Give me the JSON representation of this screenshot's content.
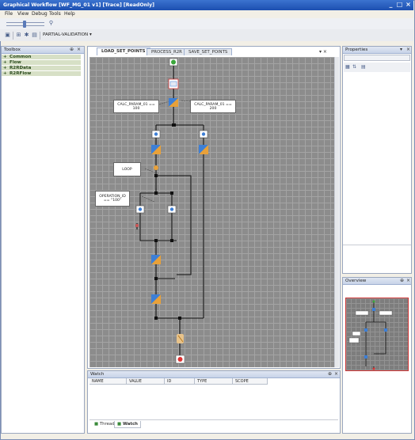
{
  "window": {
    "title": "Graphical Workflow [WF_MG_01 v1] [Trace] [ReadOnly]",
    "controls": [
      "_",
      "□",
      "×"
    ]
  },
  "menu": [
    "File",
    "View",
    "Debug",
    "Tools",
    "Help"
  ],
  "toolbar": {
    "mode_label": "PARTIAL-VALIDATION"
  },
  "toolbox": {
    "title": "Toolbox",
    "pin": "⊕",
    "close": "×",
    "items": [
      "Common",
      "Flow",
      "R2RData",
      "R2RFlow"
    ]
  },
  "document": {
    "tabs": [
      "LOAD_SET_POINTS",
      "PROCESS_R2R",
      "SAVE_SET_POINTS"
    ],
    "active_tab": "LOAD_SET_POINTS",
    "close_glyph": "▾ ×"
  },
  "workflow": {
    "notes": [
      "CALC_PARAM_01 == 100",
      "CALC_PARAM_01 == 200",
      "LOOP",
      "OPERATION_ID == \"100\""
    ]
  },
  "watch": {
    "title": "Watch",
    "columns": [
      "NAME",
      "VALUE",
      "ID",
      "TYPE",
      "SCOPE"
    ],
    "tabs": [
      "Thread",
      "Watch"
    ]
  },
  "properties": {
    "title": "Properties"
  },
  "overview": {
    "title": "Overview"
  },
  "colors": {
    "title_bar": "#1c4fb0",
    "canvas": "#8c8c8c",
    "toolbox_item_bg": "#d7e0c6",
    "node_blue": "#3d7fd6",
    "node_orange": "#e8a13a",
    "end_red": "#d33"
  }
}
